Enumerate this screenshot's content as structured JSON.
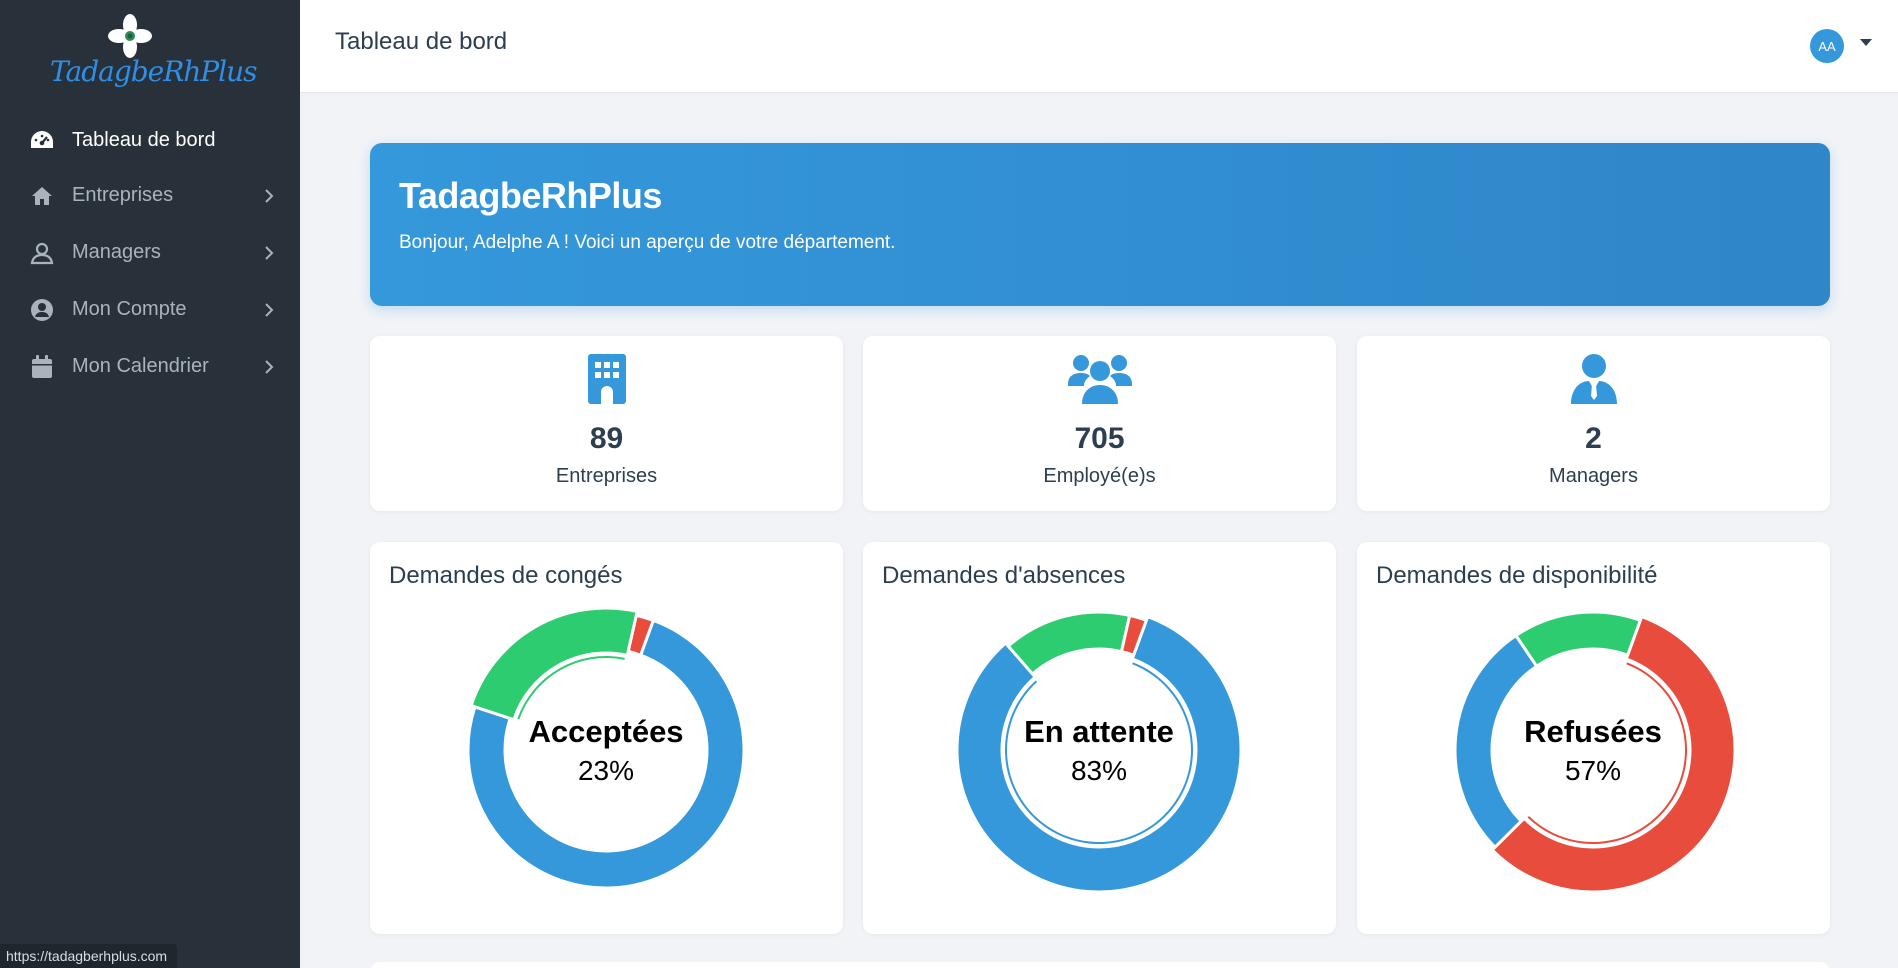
{
  "app": {
    "logo_text": "TadagbeRhPlus",
    "status_url": "https://tadagberhplus.com"
  },
  "sidebar": {
    "items": [
      {
        "label": "Tableau de bord",
        "icon": "gauge-icon",
        "active": true
      },
      {
        "label": "Entreprises",
        "icon": "home-icon",
        "active": false
      },
      {
        "label": "Managers",
        "icon": "user-outline-icon",
        "active": false
      },
      {
        "label": "Mon Compte",
        "icon": "user-circle-icon",
        "active": false
      },
      {
        "label": "Mon Calendrier",
        "icon": "calendar-icon",
        "active": false
      }
    ]
  },
  "header": {
    "title": "Tableau de bord",
    "avatar_initials": "AA"
  },
  "banner": {
    "title": "TadagbeRhPlus",
    "subtitle": "Bonjour, Adelphe A ! Voici un aperçu de votre département."
  },
  "stats": [
    {
      "value": "89",
      "label": "Entreprises",
      "icon": "building-icon"
    },
    {
      "value": "705",
      "label": "Employé(e)s",
      "icon": "users-icon"
    },
    {
      "value": "2",
      "label": "Managers",
      "icon": "user-tie-icon"
    }
  ],
  "colors": {
    "accent": "#3498db",
    "success": "#2ecc71",
    "danger": "#e74c3c",
    "sidebar_bg": "#283139"
  },
  "chart_data": [
    {
      "type": "pie",
      "title": "Demandes de congés",
      "center_label": "Acceptées",
      "center_value": "23%",
      "highlighted": 1,
      "slices": [
        {
          "color": "#3498db",
          "value": 73
        },
        {
          "color": "#2ecc71",
          "value": 23
        },
        {
          "color": "#e74c3c",
          "value": 2
        }
      ]
    },
    {
      "type": "pie",
      "title": "Demandes d'absences",
      "center_label": "En attente",
      "center_value": "83%",
      "highlighted": 0,
      "slices": [
        {
          "color": "#3498db",
          "value": 83
        },
        {
          "color": "#2ecc71",
          "value": 15
        },
        {
          "color": "#e74c3c",
          "value": 2
        }
      ]
    },
    {
      "type": "pie",
      "title": "Demandes de disponibilité",
      "center_label": "Refusées",
      "center_value": "57%",
      "highlighted": 0,
      "slices": [
        {
          "color": "#e74c3c",
          "value": 57
        },
        {
          "color": "#3498db",
          "value": 28
        },
        {
          "color": "#2ecc71",
          "value": 15
        }
      ]
    }
  ]
}
